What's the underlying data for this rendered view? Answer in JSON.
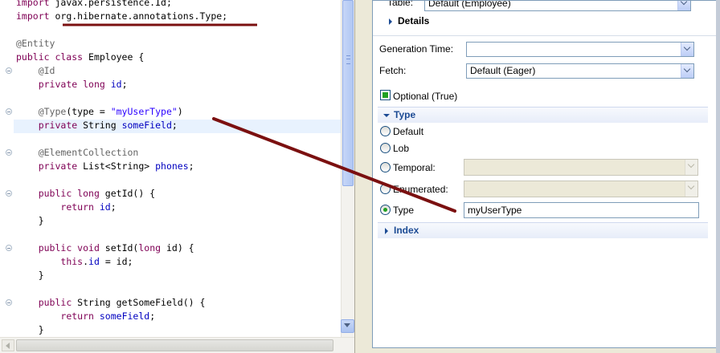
{
  "editor": {
    "lines": [
      [
        {
          "t": "import",
          "c": "kw"
        },
        {
          "t": " javax.persistence.Id;"
        }
      ],
      [
        {
          "t": "import",
          "c": "kw"
        },
        {
          "t": " org.hibernate.annotations.Type;"
        }
      ],
      [],
      [
        {
          "t": "@Entity",
          "c": "an"
        }
      ],
      [
        {
          "t": "public class",
          "c": "kw"
        },
        {
          "t": " Employee {"
        }
      ],
      [
        {
          "t": "    @Id",
          "c": "an"
        }
      ],
      [
        {
          "t": "    "
        },
        {
          "t": "private long",
          "c": "kw"
        },
        {
          "t": " "
        },
        {
          "t": "id",
          "c": "fd"
        },
        {
          "t": ";"
        }
      ],
      [],
      [
        {
          "t": "    @Type",
          "c": "an"
        },
        {
          "t": "(type = "
        },
        {
          "t": "\"myUserType\"",
          "c": "st"
        },
        {
          "t": ")"
        }
      ],
      [
        {
          "t": "    "
        },
        {
          "t": "private",
          "c": "kw"
        },
        {
          "t": " String "
        },
        {
          "t": "someField",
          "c": "fd"
        },
        {
          "t": ";"
        }
      ],
      [],
      [
        {
          "t": "    @ElementCollection",
          "c": "an"
        }
      ],
      [
        {
          "t": "    "
        },
        {
          "t": "private",
          "c": "kw"
        },
        {
          "t": " List<String> "
        },
        {
          "t": "phones",
          "c": "fd"
        },
        {
          "t": ";"
        }
      ],
      [],
      [
        {
          "t": "    "
        },
        {
          "t": "public long",
          "c": "kw"
        },
        {
          "t": " getId() {"
        }
      ],
      [
        {
          "t": "        "
        },
        {
          "t": "return",
          "c": "kw"
        },
        {
          "t": " "
        },
        {
          "t": "id",
          "c": "fd"
        },
        {
          "t": ";"
        }
      ],
      [
        {
          "t": "    }"
        }
      ],
      [],
      [
        {
          "t": "    "
        },
        {
          "t": "public void",
          "c": "kw"
        },
        {
          "t": " setId("
        },
        {
          "t": "long",
          "c": "kw"
        },
        {
          "t": " id) {"
        }
      ],
      [
        {
          "t": "        "
        },
        {
          "t": "this",
          "c": "kw"
        },
        {
          "t": "."
        },
        {
          "t": "id",
          "c": "fd"
        },
        {
          "t": " = id;"
        }
      ],
      [
        {
          "t": "    }"
        }
      ],
      [],
      [
        {
          "t": "    "
        },
        {
          "t": "public",
          "c": "kw"
        },
        {
          "t": " String getSomeField() {"
        }
      ],
      [
        {
          "t": "        "
        },
        {
          "t": "return",
          "c": "kw"
        },
        {
          "t": " "
        },
        {
          "t": "someField",
          "c": "fd"
        },
        {
          "t": ";"
        }
      ],
      [
        {
          "t": "    }"
        }
      ]
    ]
  },
  "panel": {
    "table_label": "Table:",
    "table_value": "Default (Employee)",
    "details_title": "Details",
    "generation_time_label": "Generation Time:",
    "generation_time_value": "",
    "fetch_label": "Fetch:",
    "fetch_value": "Default (Eager)",
    "optional_label": "Optional (True)",
    "type_section_title": "Type",
    "radio_default": "Default",
    "radio_lob": "Lob",
    "radio_temporal": "Temporal:",
    "temporal_value": "",
    "radio_enumerated": "Enumerated:",
    "enumerated_value": "",
    "radio_type": "Type",
    "type_value": "myUserType",
    "index_section_title": "Index"
  },
  "colors": {
    "annotation_arrow": "#7b1010",
    "keyword": "#7f0055",
    "field": "#0000c0",
    "string": "#2a00ff",
    "annotation": "#646464",
    "section_title": "#1c4b94"
  }
}
